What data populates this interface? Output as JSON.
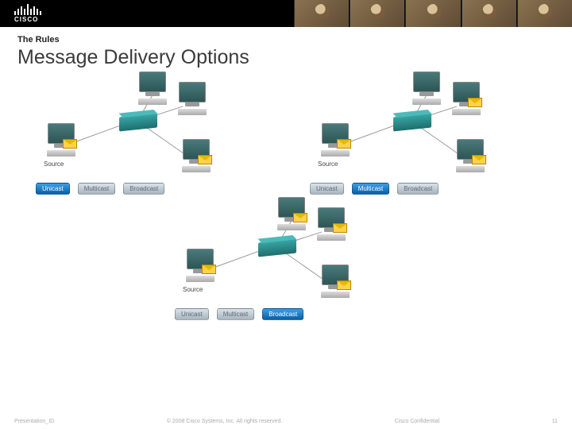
{
  "header": {
    "logo_text": "CISCO"
  },
  "pretitle": "The Rules",
  "title": "Message Delivery Options",
  "labels": {
    "source": "Source"
  },
  "pills": {
    "unicast": "Unicast",
    "multicast": "Multicast",
    "broadcast": "Broadcast"
  },
  "chart_data": [
    {
      "name": "Unicast",
      "targets": 3,
      "receiving": 1,
      "active_button": "Unicast"
    },
    {
      "name": "Multicast",
      "targets": 3,
      "receiving": 2,
      "active_button": "Multicast"
    },
    {
      "name": "Broadcast",
      "targets": 3,
      "receiving": 3,
      "active_button": "Broadcast"
    }
  ],
  "footer": {
    "left": "Presentation_ID",
    "center": "© 2008 Cisco Systems, Inc. All rights reserved.",
    "right": "Cisco Confidential",
    "page": "11"
  }
}
